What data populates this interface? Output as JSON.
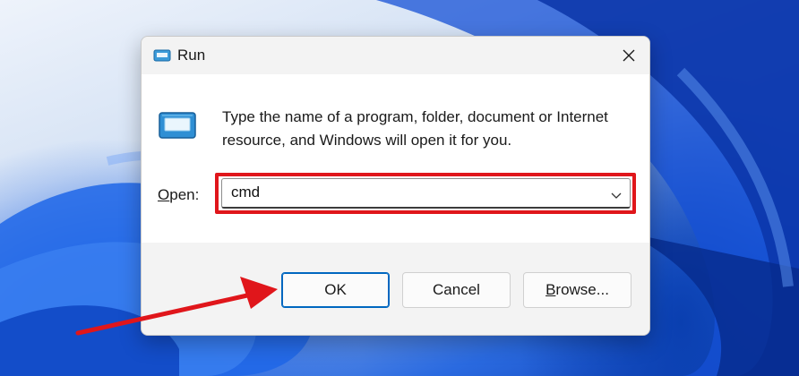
{
  "window": {
    "title": "Run",
    "icon": "run-app-icon",
    "close_icon": "close-icon"
  },
  "content": {
    "description": "Type the name of a program, folder, document or Internet resource, and Windows will open it for you.",
    "open_label_first": "O",
    "open_label_rest": "pen:",
    "open_value": "cmd",
    "dropdown_icon": "chevron-down-icon"
  },
  "buttons": {
    "ok": "OK",
    "cancel": "Cancel",
    "browse_first": "B",
    "browse_rest": "rowse..."
  },
  "annotation": {
    "highlight_color": "#e0161b",
    "arrow_color": "#e0161b",
    "arrow_target": "OK button"
  },
  "colors": {
    "accent": "#0067c0",
    "wallpaper_blue": "#1b5fe0"
  }
}
